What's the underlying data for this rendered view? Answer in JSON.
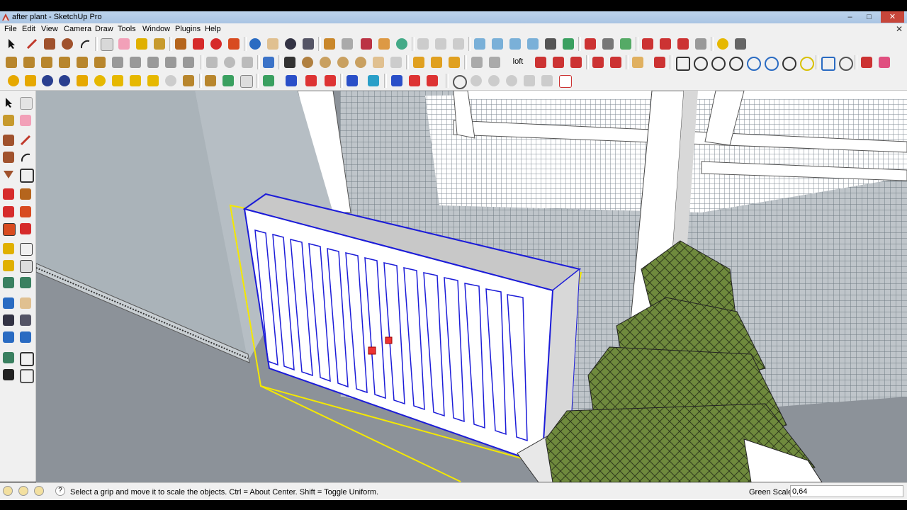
{
  "window": {
    "title": "after plant - SketchUp Pro",
    "controls": {
      "minimize": "–",
      "maximize": "□",
      "close": "✕"
    }
  },
  "menu": [
    "File",
    "Edit",
    "View",
    "Camera",
    "Draw",
    "Tools",
    "Window",
    "Plugins",
    "Help"
  ],
  "toolbar": {
    "loft_label": "loft"
  },
  "status": {
    "message": "Select a grip and move it to scale the objects. Ctrl = About Center. Shift = Toggle Uniform.",
    "vcb_label": "Green Scale",
    "vcb_value": "0,64"
  },
  "colors": {
    "selection_yellow": "#f4e800",
    "selection_blue": "#1c1cd8",
    "radiator_white": "#ffffff",
    "floor_gray": "#8c9299",
    "wall_gray": "#aab3b9",
    "plant_green": "#5f7a35"
  }
}
